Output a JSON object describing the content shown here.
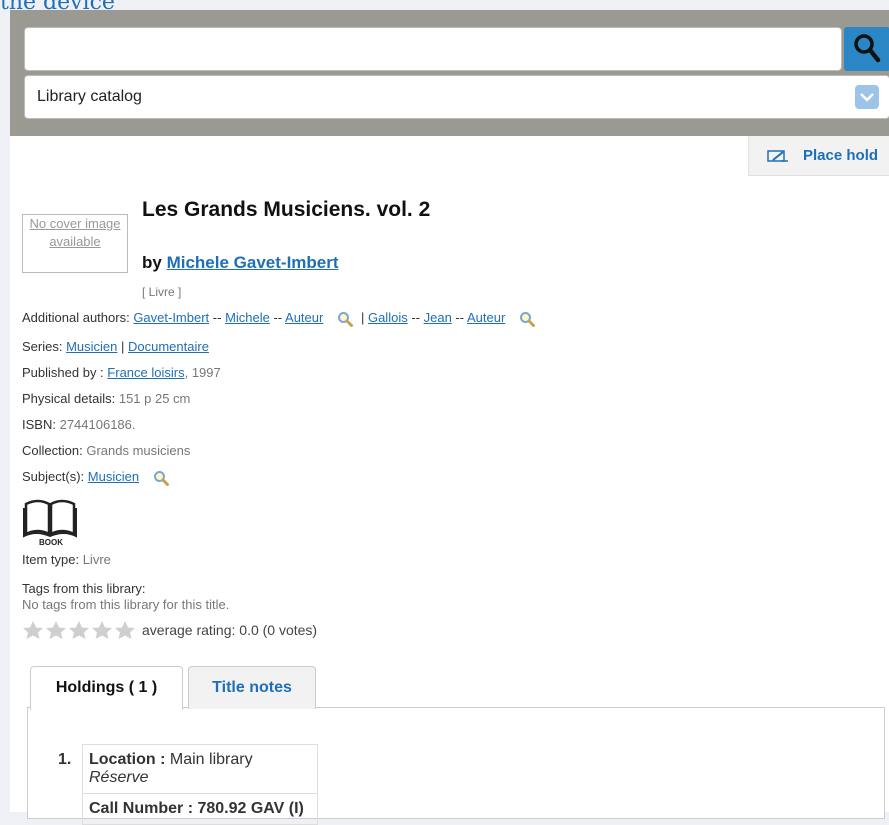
{
  "top_link": "the device",
  "search": {
    "query": "",
    "scope": "Library catalog"
  },
  "actions": {
    "place_hold": "Place hold"
  },
  "cover": {
    "no_cover_text": "No cover image available"
  },
  "record": {
    "title": "Les Grands Musiciens. vol. 2",
    "by_label": "by",
    "author": "Michele Gavet-Imbert",
    "record_type": "[ Livre ]",
    "additional_authors_label": "Additional authors:",
    "additional_authors": [
      {
        "name": "Gavet-Imbert",
        "first": "Michele",
        "role": "Auteur"
      },
      {
        "name": "Gallois",
        "first": "Jean",
        "role": "Auteur"
      }
    ],
    "series_label": "Series:",
    "series": [
      "Musicien",
      "Documentaire"
    ],
    "published_label": "Published by :",
    "publisher": "France loisirs",
    "year": ", 1997",
    "physical_label": "Physical details:",
    "physical": "151 p 25 cm",
    "isbn_label": "ISBN:",
    "isbn": "2744106186.",
    "collection_label": "Collection:",
    "collection": "Grands musiciens",
    "subjects_label": "Subject(s):",
    "subject": "Musicien",
    "item_type_caption": "BOOK",
    "item_type_label": "Item type:",
    "item_type": "Livre",
    "tags_label": "Tags from this library:",
    "tags_empty": "No tags from this library for this title.",
    "rating_text": "average rating: 0.0 (0 votes)",
    "rating_value": 0
  },
  "tabs": {
    "holdings": "Holdings ( 1 )",
    "title_notes": "Title notes"
  },
  "holdings": {
    "num": "1.",
    "location_label": "Location :",
    "location": "Main library",
    "sublocation": "Réserve",
    "call_number": "Call Number : 780.92 GAV (I)"
  },
  "colors": {
    "accent": "#1e6fb8",
    "search_bg": "#9a9a92",
    "search_button": "#2a86c5"
  }
}
